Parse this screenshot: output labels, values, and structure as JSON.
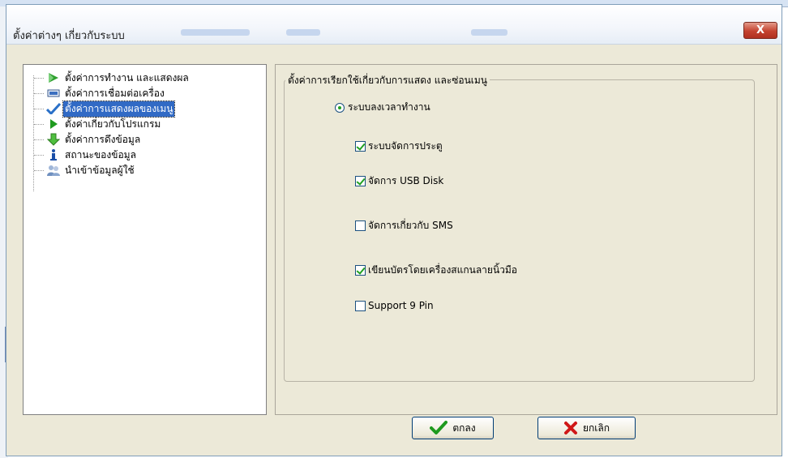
{
  "dialog": {
    "title": "ตั้งค่าต่างๆ เกี่ยวกับระบบ",
    "close_label": "X"
  },
  "tree": {
    "items": [
      {
        "label": "ตั้งค่าการทำงาน และแสดงผล",
        "icon": "green-arrow-icon",
        "selected": false
      },
      {
        "label": "ตั้งค่าการเชื่อมต่อเครื่อง",
        "icon": "monitor-icon",
        "selected": false
      },
      {
        "label": "ตั้งค่าการแสดงผลของเมนู",
        "icon": "checkmark-icon",
        "selected": true
      },
      {
        "label": "ตั้งค่าเกี่ยวกับโปรแกรม",
        "icon": "play-icon",
        "selected": false
      },
      {
        "label": "ตั้งค่าการดึงข้อมูล",
        "icon": "down-arrow-icon",
        "selected": false
      },
      {
        "label": "สถานะของข้อมูล",
        "icon": "info-icon",
        "selected": false
      },
      {
        "label": "นำเข้าข้อมูลผู้ใช้",
        "icon": "users-icon",
        "selected": false
      }
    ]
  },
  "group": {
    "title": "ตั้งค่าการเรียกใช้เกี่ยวกับการแสดง และซ่อนเมนู",
    "radio_label": "ระบบลงเวลาทำงาน",
    "radio_selected": true,
    "checkboxes": [
      {
        "label": "ระบบจัดการประตู",
        "checked": true
      },
      {
        "label": "จัดการ USB Disk",
        "checked": true
      },
      {
        "label": "จัดการเกี่ยวกับ SMS",
        "checked": false
      },
      {
        "label": "เขียนบัตรโดยเครื่องสแกนลายนิ้วมือ",
        "checked": true
      },
      {
        "label": "Support 9 Pin",
        "checked": false
      }
    ]
  },
  "buttons": {
    "ok_label": "ตกลง",
    "cancel_label": "ยกเลิก"
  },
  "colors": {
    "selection": "#316ac5",
    "check_green": "#21a121",
    "cancel_red": "#d01818"
  }
}
